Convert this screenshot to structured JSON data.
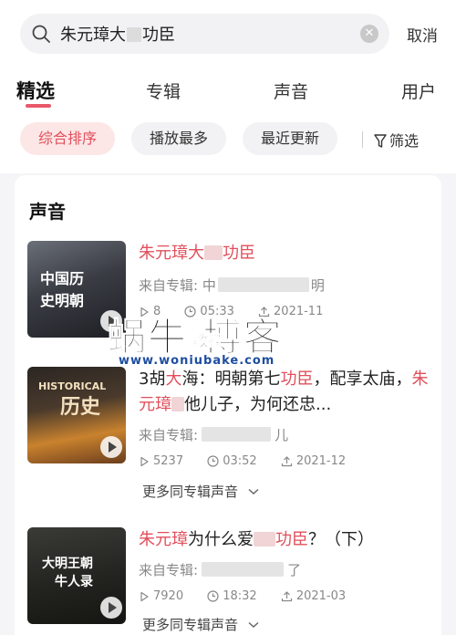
{
  "search": {
    "query_prefix": "朱元璋大",
    "query_suffix": "功臣",
    "cancel_label": "取消"
  },
  "tabs": [
    {
      "label": "精选"
    },
    {
      "label": "专辑"
    },
    {
      "label": "声音"
    },
    {
      "label": "用户"
    }
  ],
  "filters": {
    "sort_comprehensive": "综合排序",
    "sort_most_played": "播放最多",
    "sort_recent": "最近更新",
    "filter_label": "筛选"
  },
  "section": {
    "title": "声音"
  },
  "items": [
    {
      "cover_text_1": "中国历",
      "cover_text_2": "史明朝",
      "title_a": "朱元璋大",
      "title_b": "功臣",
      "album_prefix": "来自专辑: 中",
      "album_suffix": "明",
      "plays": "8",
      "duration": "05:33",
      "date": "2021-11"
    },
    {
      "cover_text_1": "HISTORICAL",
      "cover_text_2": "历史",
      "title_1": "3胡",
      "title_2": "大",
      "title_3": "海：明朝第七",
      "title_4": "功臣",
      "title_5": "，配享太庙，",
      "title_6": "朱元璋",
      "title_7": "他儿子，为何还忠...",
      "album_prefix": "来自专辑:",
      "album_suffix": "儿",
      "plays": "5237",
      "duration": "03:52",
      "date": "2021-12",
      "more_label": "更多同专辑声音"
    },
    {
      "cover_text_1": "大明王朝",
      "cover_text_2": "牛人录",
      "title_a": "朱元璋",
      "title_b": "为什么爱",
      "title_c": "功臣",
      "title_d": "？（下）",
      "album_prefix": "来自专辑:",
      "album_suffix": "了",
      "plays": "7920",
      "duration": "18:32",
      "date": "2021-03",
      "more_label": "更多同专辑声音"
    }
  ],
  "watermark": {
    "big": "蜗牛  博客",
    "small": "教授",
    "url": "www.woniubake.com"
  },
  "colors": {
    "accent": "#e0505c",
    "chip_active_bg": "#fde6e6",
    "underline": "#e8586a"
  }
}
